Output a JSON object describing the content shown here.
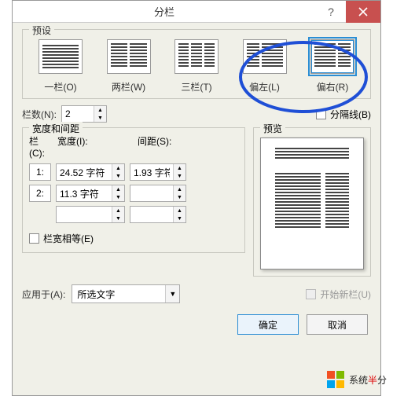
{
  "titlebar": {
    "title": "分栏"
  },
  "presets": {
    "legend": "预设",
    "items": [
      {
        "label": "一栏(O)"
      },
      {
        "label": "两栏(W)"
      },
      {
        "label": "三栏(T)"
      },
      {
        "label": "偏左(L)"
      },
      {
        "label": "偏右(R)"
      }
    ]
  },
  "columns": {
    "count_label": "栏数(N):",
    "count_value": "2",
    "separator_label": "分隔线(B)"
  },
  "width_spacing": {
    "legend": "宽度和间距",
    "col_header": "栏(C):",
    "width_header": "宽度(I):",
    "spacing_header": "间距(S):",
    "rows": [
      {
        "num": "1:",
        "width": "24.52 字符",
        "spacing": "1.93 字符"
      },
      {
        "num": "2:",
        "width": "11.3 字符",
        "spacing": ""
      },
      {
        "num": "",
        "width": "",
        "spacing": ""
      }
    ],
    "equal_label": "栏宽相等(E)"
  },
  "preview": {
    "legend": "预览"
  },
  "apply": {
    "label": "应用于(A):",
    "value": "所选文字",
    "new_column_label": "开始新栏(U)"
  },
  "buttons": {
    "ok": "确定",
    "cancel": "取消"
  },
  "watermark": {
    "brand_a": "系统",
    "brand_b": "半",
    "brand_c": "分"
  }
}
